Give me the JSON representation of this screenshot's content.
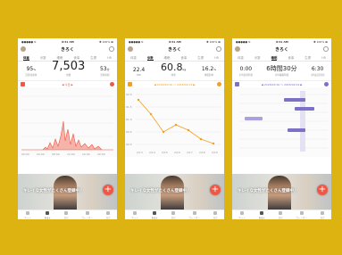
{
  "accent": "#ee5845",
  "status": {
    "carrier": "●●●●● ≋",
    "time": "9:41 AM",
    "battery": "✱ 100% ▬"
  },
  "app_title": "きろく",
  "tabs": [
    "体重",
    "歩数",
    "睡眠",
    "食事",
    "生理",
    "HR"
  ],
  "ad_text": "キレイな女性がたくさん登録中♪",
  "fab_label": "+",
  "nav": [
    "ホーム",
    "きろく",
    "日記",
    "カレンダー",
    "設定"
  ],
  "screen1": {
    "stats": [
      {
        "value": "95",
        "unit": "%",
        "label": "目標達成率"
      },
      {
        "value": "7,503",
        "unit": "",
        "label": "歩数"
      },
      {
        "value": "53",
        "unit": "分",
        "label": "活動時間"
      }
    ],
    "chart_label": "◀ 今日 ▶",
    "times": [
      "00:00",
      "04:00",
      "08:00",
      "12:00",
      "16:00",
      "20:00"
    ]
  },
  "screen2": {
    "stats": [
      {
        "value": "22.4",
        "unit": "",
        "label": "BMI"
      },
      {
        "value": "60.8",
        "unit": "kg",
        "label": "体重"
      },
      {
        "value": "16.2",
        "unit": "%",
        "label": "体脂肪率"
      }
    ],
    "chart_label": "◀ 2018/02/16 ～ 2018/02/19 ▶",
    "y_ticks": [
      "62.0",
      "61.5",
      "61.0",
      "60.5",
      "60.0"
    ],
    "x_ticks": [
      "2/13",
      "2/14",
      "2/15",
      "2/16",
      "2/17",
      "2/18",
      "2/19"
    ]
  },
  "screen3": {
    "stats": [
      {
        "value": "0:00",
        "unit": "",
        "label": "平均就寝時刻"
      },
      {
        "value": "6時間30分",
        "unit": "",
        "label": "平均睡眠時間"
      },
      {
        "value": "6:30",
        "unit": "",
        "label": "平均起床時刻"
      }
    ],
    "chart_label": "◀ 2018/02/16 ～ 2018/02/19 ▶"
  }
}
